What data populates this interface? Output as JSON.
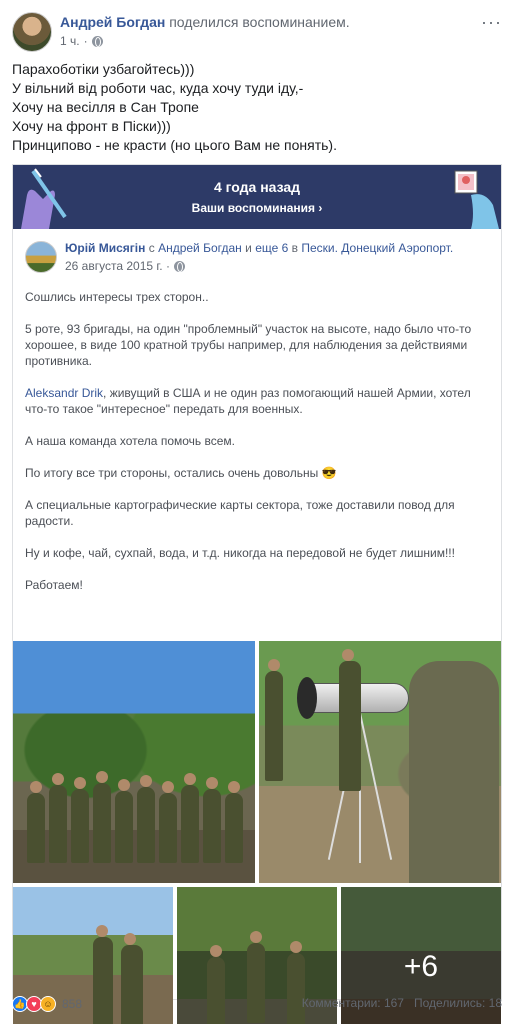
{
  "header": {
    "author": "Андрей Богдан",
    "action": "поделился воспоминанием.",
    "time": "1 ч.",
    "more": "···"
  },
  "post_text": [
    "Парахоботіки узбагойтесь)))",
    "У вільний від роботи час, куда хочу туди іду,-",
    "Хочу на весілля в Сан Тропе",
    "Хочу на фронт в Піски)))",
    "Принципово - не красти (но цього Вам не понять)."
  ],
  "memory": {
    "title": "4 года назад",
    "subtitle": "Ваши воспоминания",
    "chevron": "›"
  },
  "shared": {
    "author": "Юрій Мисягін",
    "with_prefix": "с",
    "with_name": "Андрей Богдан",
    "and": "и",
    "others": "еще 6",
    "in": "в",
    "place": "Пески. Донецкий Аэропорт.",
    "date": "26 августа 2015 г. ·",
    "paragraphs": {
      "p1": "Сошлись интересы трех сторон..",
      "p2": "5 роте, 93 бригады, на один \"проблемный\" участок на высоте, надо было что-то хорошее, в виде 100 кратной трубы например, для наблюдения за действиями противника.",
      "p3_tag": "Aleksandr Drik",
      "p3_rest": ", живущий в США и не один раз помогающий нашей Армии, хотел что-то такое \"интересное\" передать для военных.",
      "p4": "А наша команда хотела помочь всем.",
      "p5": "По итогу все три стороны, остались очень довольны 😎",
      "p6": "А специальные картографические карты сектора, тоже доставили повод для радости.",
      "p7": "Ну и кофе, чай, сухпай, вода, и т.д. никогда на передовой не будет лишним!!!",
      "p8": "Работаем!"
    }
  },
  "photos": {
    "more_count": "+6"
  },
  "footer": {
    "reaction_count": "858",
    "comments": "Комментарии: 167",
    "shares": "Поделились: 18",
    "reaction_icons": [
      "like-icon",
      "love-icon",
      "haha-icon"
    ]
  }
}
